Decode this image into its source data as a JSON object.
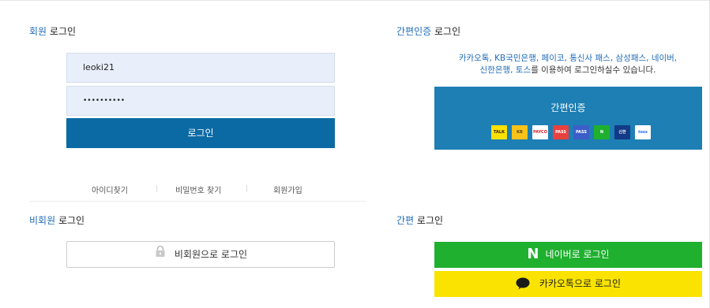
{
  "member": {
    "title_accent": "회원",
    "title_rest": " 로그인",
    "id_value": "leoki21",
    "password_value": "••••••••••",
    "login_label": "로그인",
    "links": [
      "아이디찾기",
      "비밀번호 찾기",
      "회원가입"
    ]
  },
  "guest": {
    "title_accent": "비회원",
    "title_rest": " 로그인",
    "button_label": "비회원으로 로그인"
  },
  "easy_auth": {
    "title_accent": "간편인증",
    "title_rest": " 로그인",
    "desc_blue_1": "카카오톡, KB국민은행, 페이코, 통신사 패스, 삼성패스, 네이버,",
    "desc_blue_2": "신한은행, 토스",
    "desc_rest": "를 이용하여 로그인하실수 있습니다.",
    "button_label": "간편인증",
    "providers": [
      {
        "name": "TALK",
        "bg": "#fae100",
        "fg": "#3c1e1e"
      },
      {
        "name": "KB",
        "bg": "#f7c21a",
        "fg": "#5a4a2a"
      },
      {
        "name": "PAYCO",
        "bg": "#ffffff",
        "fg": "#e0262b"
      },
      {
        "name": "PASS",
        "bg": "#e8413d",
        "fg": "#ffffff"
      },
      {
        "name": "PASS",
        "bg": "#3b5ec9",
        "fg": "#ffffff"
      },
      {
        "name": "N",
        "bg": "#1fb02f",
        "fg": "#ffffff"
      },
      {
        "name": "신한",
        "bg": "#123a86",
        "fg": "#ffffff"
      },
      {
        "name": "toss",
        "bg": "#ffffff",
        "fg": "#1f6bf5"
      }
    ]
  },
  "simple": {
    "title_accent": "간편",
    "title_rest": " 로그인",
    "naver_label": "네이버로 로그인",
    "naver_icon": "N",
    "kakao_label": "카카오톡으로 로그인"
  }
}
